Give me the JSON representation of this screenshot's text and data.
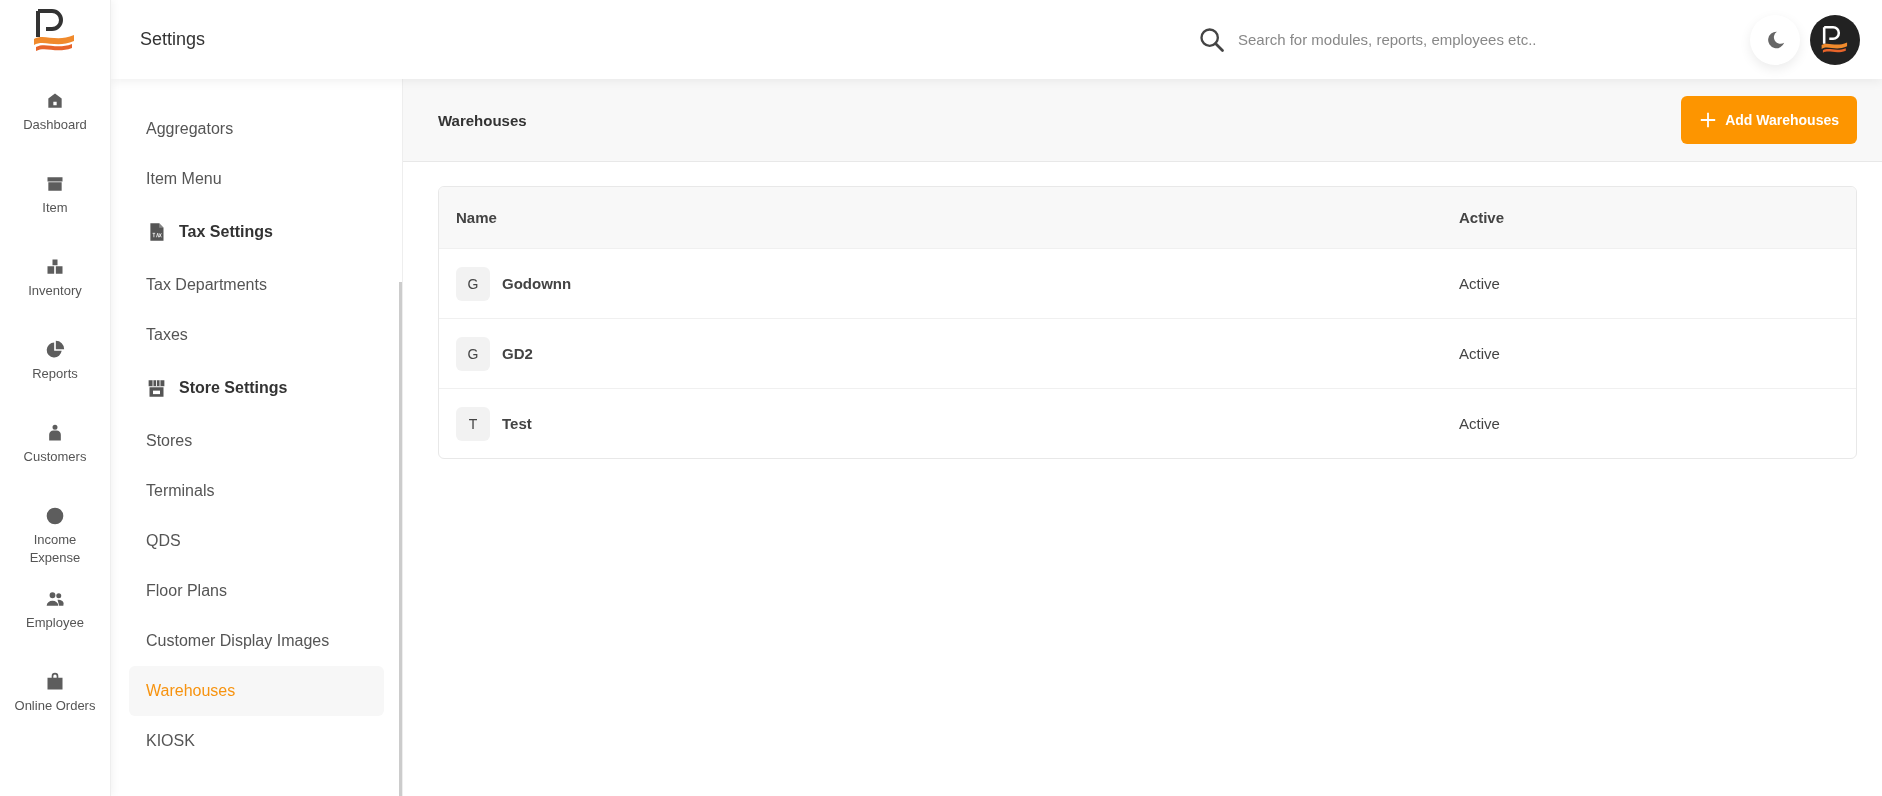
{
  "nav_rail": [
    {
      "label": "Dashboard"
    },
    {
      "label": "Item"
    },
    {
      "label": "Inventory"
    },
    {
      "label": "Reports"
    },
    {
      "label": "Customers"
    },
    {
      "label": "Income Expense"
    },
    {
      "label": "Employee"
    },
    {
      "label": "Online Orders"
    }
  ],
  "top_bar": {
    "title": "Settings",
    "search": {
      "placeholder": "Search for modules, reports, employees etc.."
    }
  },
  "settings_menu": [
    {
      "kind": "link",
      "label": "Aggregators",
      "selected": false
    },
    {
      "kind": "link",
      "label": "Item Menu",
      "selected": false
    },
    {
      "kind": "section",
      "label": "Tax Settings"
    },
    {
      "kind": "link",
      "label": "Tax Departments",
      "selected": false
    },
    {
      "kind": "link",
      "label": "Taxes",
      "selected": false
    },
    {
      "kind": "section",
      "label": "Store Settings"
    },
    {
      "kind": "link",
      "label": "Stores",
      "selected": false
    },
    {
      "kind": "link",
      "label": "Terminals",
      "selected": false
    },
    {
      "kind": "link",
      "label": "QDS",
      "selected": false
    },
    {
      "kind": "link",
      "label": "Floor Plans",
      "selected": false
    },
    {
      "kind": "link",
      "label": "Customer Display Images",
      "selected": false
    },
    {
      "kind": "link",
      "label": "Warehouses",
      "selected": true
    },
    {
      "kind": "link",
      "label": "KIOSK",
      "selected": false
    }
  ],
  "page_header": {
    "title": "Warehouses",
    "add_button": "Add Warehouses"
  },
  "table": {
    "columns": [
      "Name",
      "Active"
    ],
    "rows": [
      {
        "initial": "G",
        "name": "Godownn",
        "status": "Active"
      },
      {
        "initial": "G",
        "name": "GD2",
        "status": "Active"
      },
      {
        "initial": "T",
        "name": "Test",
        "status": "Active"
      }
    ]
  }
}
